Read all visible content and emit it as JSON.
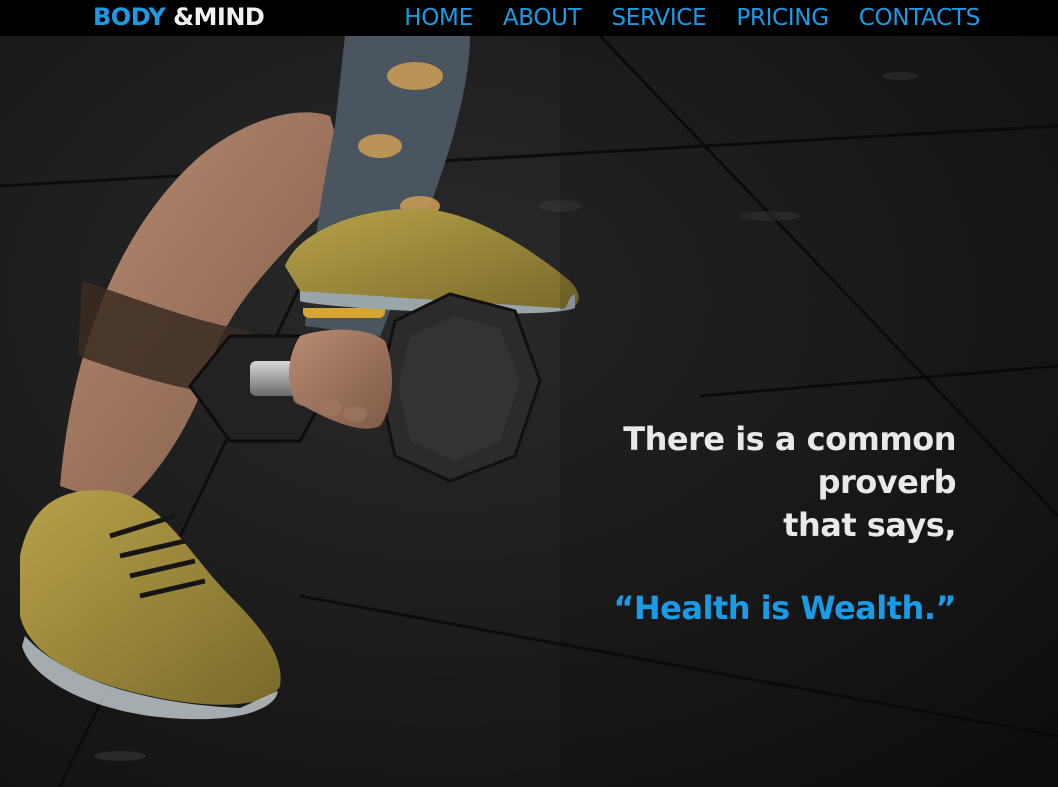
{
  "brand": {
    "part1": "BODY",
    "part2": " &MIND"
  },
  "nav": {
    "items": [
      {
        "label": "HOME"
      },
      {
        "label": "ABOUT"
      },
      {
        "label": "SERVICE"
      },
      {
        "label": "PRICING"
      },
      {
        "label": "CONTACTS"
      }
    ]
  },
  "hero": {
    "quote_lines": [
      "There is a common",
      "proverb",
      "that says,"
    ],
    "highlight": "“Health is Wealth.”"
  },
  "colors": {
    "accent": "#1a9be6",
    "nav_bg": "#000000",
    "text_light": "#e9e9e9",
    "floor": "#161616"
  }
}
